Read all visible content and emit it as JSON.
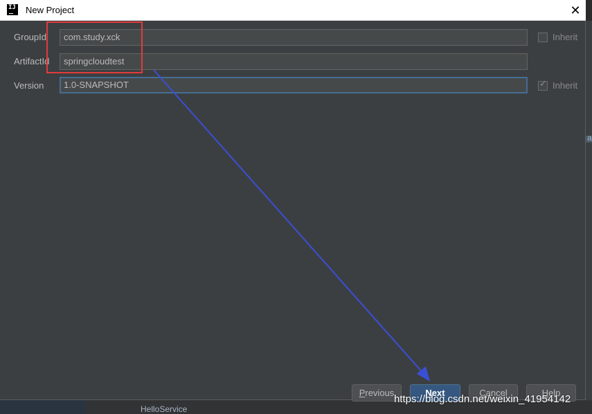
{
  "window": {
    "title": "New Project",
    "icon_text": "IJ",
    "close_glyph": "✕"
  },
  "background": {
    "bottom_text": "HelloService",
    "right_glyph": "a",
    "left_glyph": "\\s"
  },
  "form": {
    "fields": [
      {
        "label": "GroupId",
        "value": "com.study.xck",
        "inherit_label": "Inherit",
        "inherit_checked": false
      },
      {
        "label": "ArtifactId",
        "value": "springcloudtest",
        "inherit_label": "",
        "inherit_checked": false
      },
      {
        "label": "Version",
        "value": "1.0-SNAPSHOT",
        "inherit_label": "Inherit",
        "inherit_checked": true
      }
    ]
  },
  "buttons": {
    "previous": {
      "mnemonic": "P",
      "rest": "revious"
    },
    "next": {
      "mnemonic": "N",
      "rest": "ext"
    },
    "cancel": {
      "mnemonic": "C",
      "rest": "ancel"
    },
    "help": {
      "mnemonic": "H",
      "rest": "elp"
    }
  },
  "annotations": {
    "highlight_color": "#e33b3b",
    "arrow_color": "#3a4fd6"
  },
  "watermark": "https://blog.csdn.net/weixin_41954142"
}
